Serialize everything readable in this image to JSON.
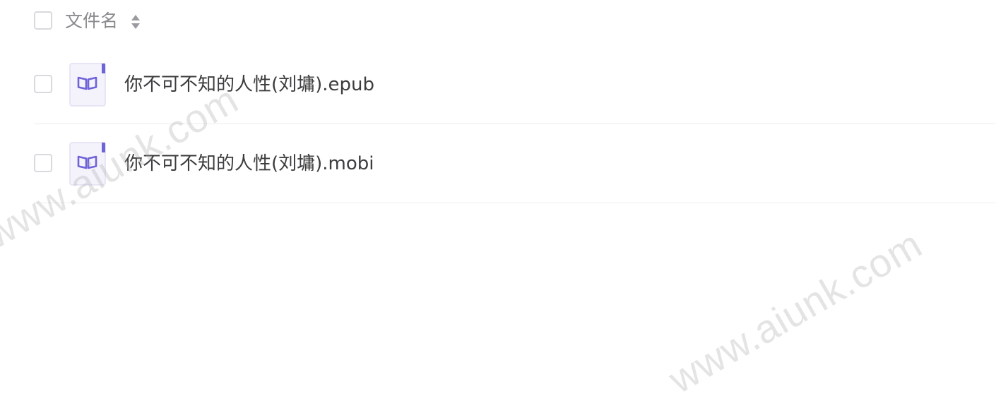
{
  "header": {
    "column_label": "文件名",
    "sort_icon": "sort-updown-icon"
  },
  "files": [
    {
      "name": "你不可不知的人性(刘墉).epub",
      "icon": "ebook-icon"
    },
    {
      "name": "你不可不知的人性(刘墉).mobi",
      "icon": "ebook-icon"
    }
  ],
  "watermark": {
    "text": "www.aiunk.com"
  },
  "colors": {
    "icon_accent": "#6f63d8",
    "icon_bg": "#f4f3fb",
    "divider": "#ededf0",
    "checkbox_border": "#d9d9de"
  }
}
